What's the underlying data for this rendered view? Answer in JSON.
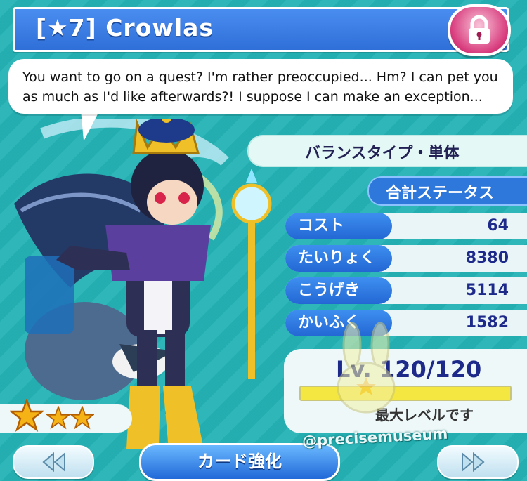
{
  "header": {
    "title": "[★7] Crowlas",
    "lock_icon": "lock-icon"
  },
  "dialogue": {
    "text": "You want to go on a quest? I'm rather preoccupied... Hm? I can pet you as much as I'd like afterwards?! I suppose I can make an exception..."
  },
  "card": {
    "type_label": "バランスタイプ・単体",
    "total_stats_label": "合計ステータス",
    "stats": [
      {
        "label": "コスト",
        "value": "64"
      },
      {
        "label": "たいりょく",
        "value": "8380"
      },
      {
        "label": "こうげき",
        "value": "5114"
      },
      {
        "label": "かいふく",
        "value": "1582"
      }
    ],
    "level": {
      "text": "Lv. 120/120",
      "fill_fraction": 1.0,
      "max_label": "最大レベルです"
    },
    "stars": 3
  },
  "nav": {
    "prev_icon": "double-chevron-left-icon",
    "next_icon": "double-chevron-right-icon",
    "enhance_label": "カード強化"
  },
  "watermark": "@precisemuseum",
  "colors": {
    "background": "#25b3b6",
    "title_blue": "#2f6fd8",
    "stat_label_blue": "#2367d4",
    "lock_pink": "#d83c7d",
    "star_gold": "#f6b315",
    "level_fill": "#f4e742"
  }
}
